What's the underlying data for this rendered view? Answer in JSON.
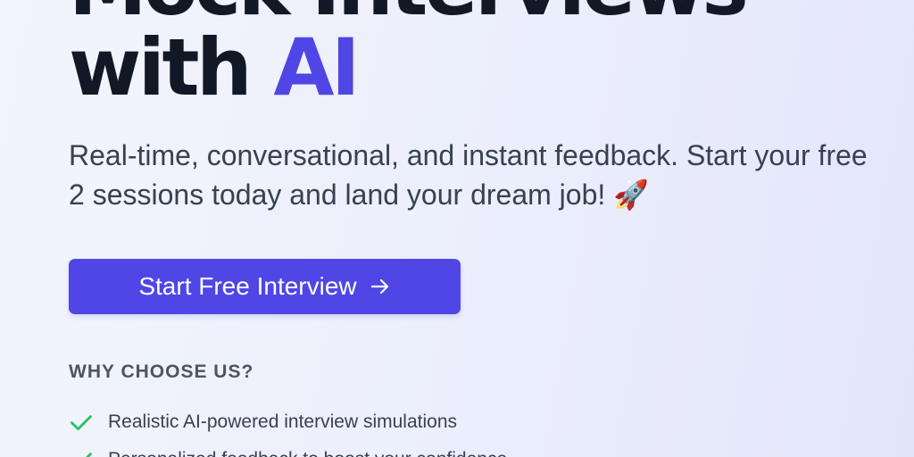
{
  "hero": {
    "headline_line1": "Mock Interviews",
    "headline_line2_prefix": "with",
    "headline_line2_accent": "AI",
    "subtitle": "Real-time, conversational, and instant feedback. Start your free 2 sessions today and land your dream job! 🚀",
    "cta_label": "Start Free Interview"
  },
  "why": {
    "title": "WHY CHOOSE US?",
    "items": [
      {
        "text": "Realistic AI-powered interview simulations"
      },
      {
        "text": "Personalized feedback to boost your confidence"
      }
    ]
  },
  "icons": {
    "cta_icon": "arrow-right-icon",
    "feature_icon": "check-icon"
  },
  "colors": {
    "accent": "#4f46e5",
    "heading": "#121826",
    "body_text": "#374151",
    "check": "#22c55e"
  }
}
